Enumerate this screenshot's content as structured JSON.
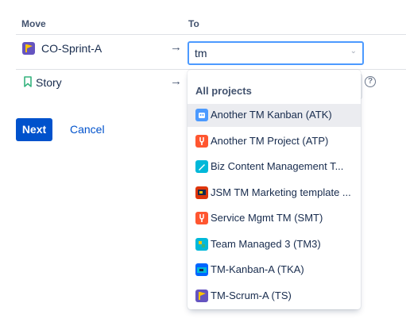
{
  "columns": {
    "move": "Move",
    "to": "To"
  },
  "rows": [
    {
      "icon": "co-sprint-project-icon",
      "label": "CO-Sprint-A",
      "arrow": "→"
    },
    {
      "icon": "story-bookmark-icon",
      "label": "Story",
      "arrow": "→"
    }
  ],
  "target_select": {
    "value": "tm",
    "chevron": "⌄"
  },
  "help_glyph": "?",
  "actions": {
    "next": "Next",
    "cancel": "Cancel"
  },
  "dropdown": {
    "header": "All projects",
    "items": [
      {
        "label": "Another TM Kanban (ATK)",
        "icon": "robot-project-icon",
        "color": "#4c9aff",
        "active": true
      },
      {
        "label": "Another TM Project (ATP)",
        "icon": "wrench-project-icon",
        "color": "#ff5630",
        "active": false
      },
      {
        "label": "Biz Content Management T...",
        "icon": "pencil-project-icon",
        "color": "#00b8d9",
        "active": false
      },
      {
        "label": "JSM TM Marketing template ...",
        "icon": "screen-project-icon",
        "color": "#de350b",
        "active": false
      },
      {
        "label": "Service Mgmt TM (SMT)",
        "icon": "wrench-project-icon",
        "color": "#ff5630",
        "active": false
      },
      {
        "label": "Team Managed 3 (TM3)",
        "icon": "puzzle-project-icon",
        "color": "#00b8d9",
        "active": false
      },
      {
        "label": "TM-Kanban-A (TKA)",
        "icon": "box-project-icon",
        "color": "#0065ff",
        "active": false
      },
      {
        "label": "TM-Scrum-A (TS)",
        "icon": "flag-project-icon",
        "color": "#6554c0",
        "active": false
      }
    ]
  },
  "colors": {
    "primary": "#0052cc",
    "focus": "#4c9aff",
    "story": "#36b37e"
  }
}
